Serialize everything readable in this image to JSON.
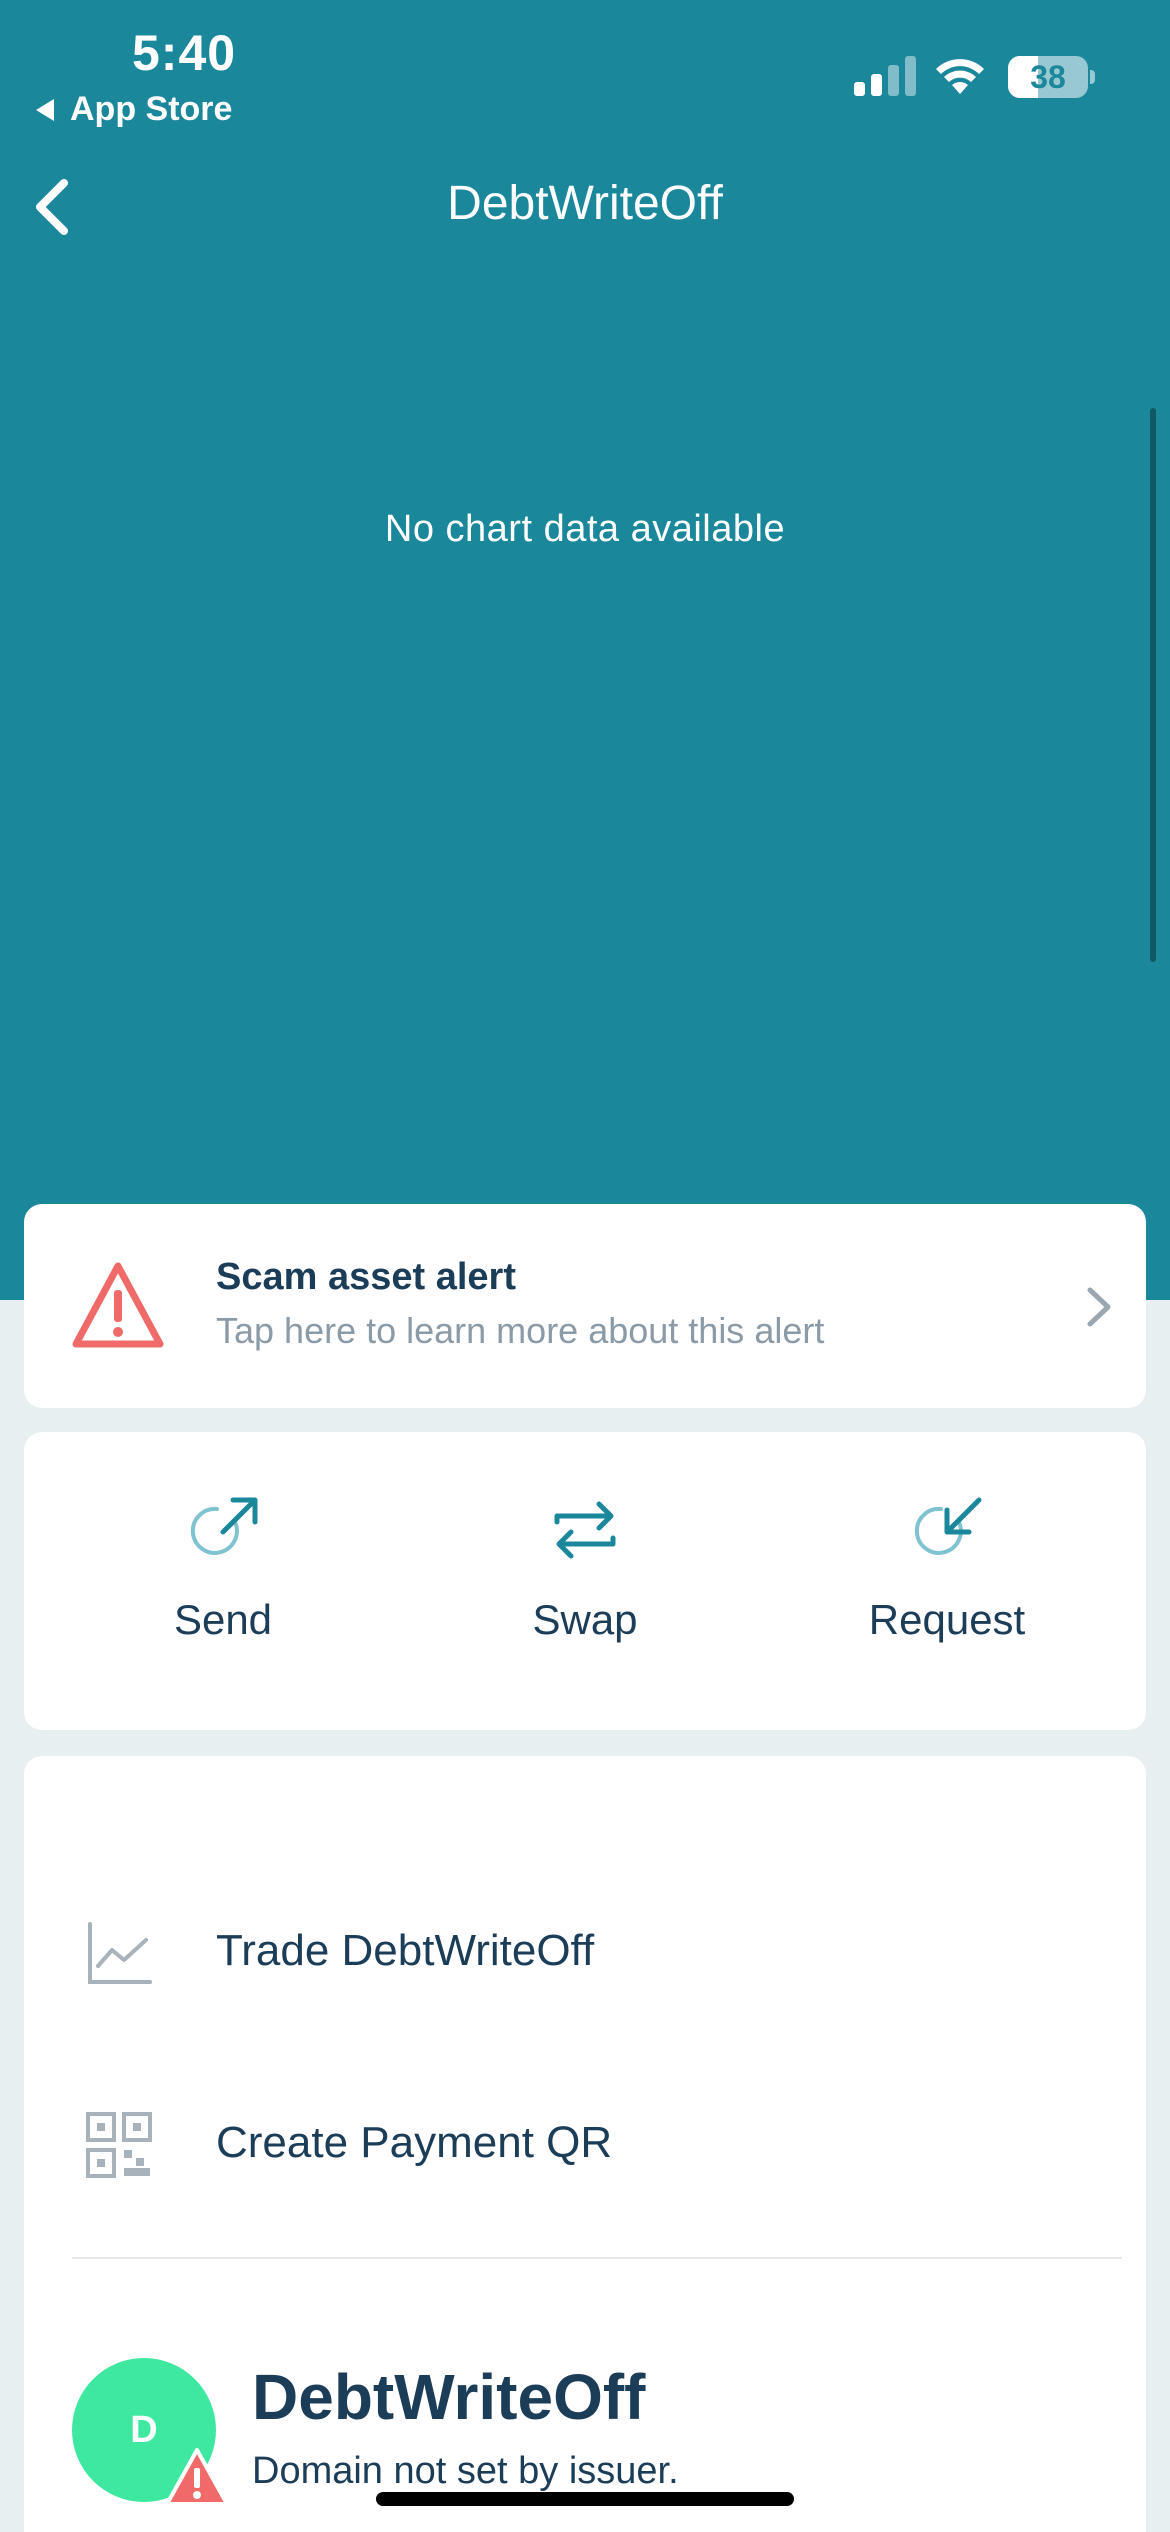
{
  "status_bar": {
    "time": "5:40",
    "back_app": "App Store",
    "battery_level": "38",
    "battery_fraction": 0.38
  },
  "nav": {
    "title": "DebtWriteOff"
  },
  "chart": {
    "empty_message": "No chart data available"
  },
  "alert": {
    "title": "Scam asset alert",
    "subtitle": "Tap here to learn more about this alert"
  },
  "actions": [
    {
      "label": "Send",
      "icon": "send-icon"
    },
    {
      "label": "Swap",
      "icon": "swap-icon"
    },
    {
      "label": "Request",
      "icon": "request-icon"
    }
  ],
  "menu": {
    "trade_label": "Trade DebtWriteOff",
    "qr_label": "Create Payment QR"
  },
  "asset": {
    "avatar_letter": "D",
    "name": "DebtWriteOff",
    "domain": "Domain not set by issuer."
  },
  "colors": {
    "header": "#1b879b",
    "background": "#e8eff1",
    "text_dark": "#1c3d57",
    "text_muted": "#8a9aa7",
    "alert": "#f06a6a",
    "avatar": "#3ee8a0"
  }
}
